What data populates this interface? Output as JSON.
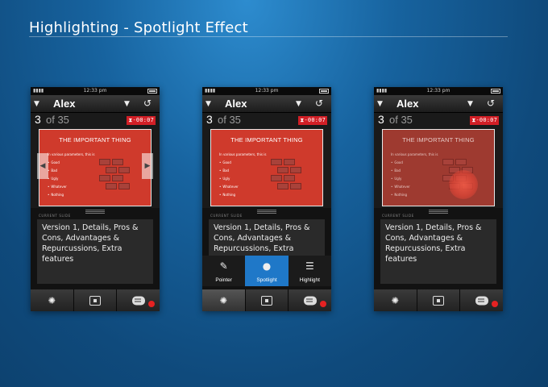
{
  "page": {
    "title": "Highlighting - Spotlight Effect"
  },
  "phone": {
    "time": "12:33 pm",
    "contact": "Alex",
    "slide_current": "3",
    "slide_of": "of 35",
    "timer": "-00:07",
    "slide": {
      "title": "THE IMPORTANT THING",
      "intro": "In various parameters, this is",
      "bullets": [
        "Good",
        "Bad",
        "Ugly",
        "Whatever",
        "Nothing"
      ]
    },
    "current_slide_label": "CURRENT SLIDE",
    "notes": "Version 1, Details, Pros & Cons, Advantages & Repurcussions, Extra features",
    "notes_truncated": "Version 1, Details, Pros & Cons, Advantages & Repurcussions, Extra",
    "bottom_bar": {
      "icons": [
        "settings-gear-icon",
        "lock-icon",
        "chat-icon"
      ],
      "badge_color": "#e62222"
    },
    "tools": [
      {
        "label": "Pointer",
        "icon": "pointer-wand-icon"
      },
      {
        "label": "Spotlight",
        "icon": "spotlight-icon",
        "selected": true
      },
      {
        "label": "Highlight",
        "icon": "highlight-lines-icon"
      }
    ],
    "colors": {
      "slide_red": "#cf3a2c",
      "timer_red": "#d21f26",
      "tool_selected": "#1f78c8"
    }
  }
}
